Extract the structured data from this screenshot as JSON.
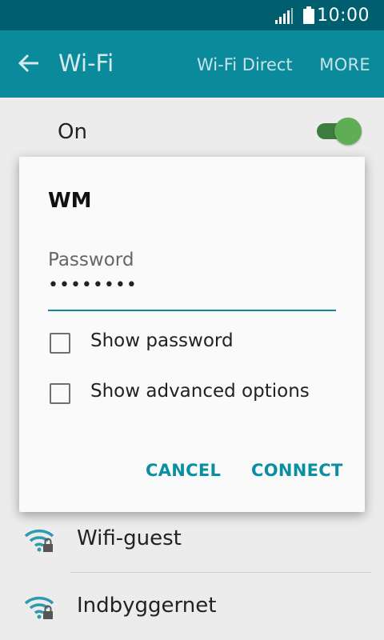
{
  "status_bar": {
    "time": "10:00"
  },
  "app_bar": {
    "title": "Wi-Fi",
    "direct_label": "Wi-Fi Direct",
    "more_label": "MORE"
  },
  "wifi_toggle": {
    "label": "On",
    "state": "on"
  },
  "networks": [
    {
      "name": "Wifi-guest",
      "icon": "wifi-locked-icon"
    },
    {
      "name": "Indbyggernet",
      "icon": "wifi-locked-icon"
    }
  ],
  "dialog": {
    "title": "WM",
    "password_label": "Password",
    "password_value": "••••••••",
    "options": [
      {
        "label": "Show password",
        "checked": false
      },
      {
        "label": "Show advanced options",
        "checked": false
      }
    ],
    "cancel_label": "CANCEL",
    "connect_label": "CONNECT"
  },
  "colors": {
    "accent": "#0a8a9b",
    "status_bar": "#005f6f",
    "toggle_on": "#5fae56"
  }
}
